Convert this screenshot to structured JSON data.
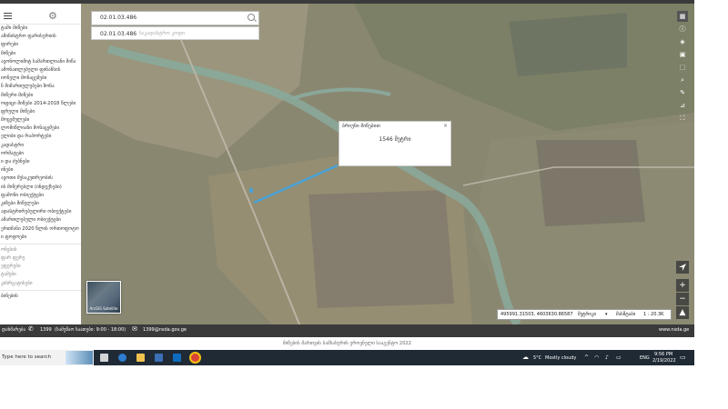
{
  "sidebar": {
    "items": [
      "ტამი მიწები",
      "ამინისტრო ფარისერიის",
      "ფირები",
      "მიწები",
      "ავონოლიმიტ სამართლიანი მიწა",
      "ამონათლებული ფინანსის",
      "იონელი მონაცემები",
      "ნ მიმართულებები ზონა",
      "მიწერი მიწები",
      "ოფიცი მიწები 2014-2018 წლები",
      "ფრული მიწები",
      "მოცემულები",
      "ლომიწლიანი მონაცემები",
      "ელიბი და რაპორტები",
      "კადასტრი",
      "ორმატები",
      "ი და ძებნები",
      "ინები",
      "ავოთი მესაკუთრეობის",
      "ის მიწერებლი (ინდექსები)",
      "ფამონი ობიექტები",
      "კიზები მიწელები",
      "ადასტრირებულირი ობიექტები",
      "ამართლებული ობიექტები",
      "ერთმანი 2020 წლის ორთოფოტო",
      "ი ფოტოები"
    ],
    "sub_items": [
      "ონების",
      "ფარ ფერე",
      "ეფერები",
      "ტამები",
      "კისრგატისები"
    ],
    "bottom_item": "ბინების",
    "thumb_label": "ArcGIS Satellite"
  },
  "search": {
    "value": "02.01.03.486",
    "suggestion_code": "02.01.03.486",
    "suggestion_desc": "საკადასტრო კოდი"
  },
  "popup": {
    "title": "ბრიუნი მიწებით",
    "value": "1546 მეტრი",
    "close": "×"
  },
  "status": {
    "coords": "495991.31503, 4603630.86587",
    "unit": "მეტრიკი",
    "scale_label": "მასშტაბი",
    "scale": "1 : 20.3K"
  },
  "footer": {
    "support": "დახმარება",
    "phone": "1399",
    "hours": "(სამუშაო საათები: 9:00 - 18:00)",
    "email": "1399@nsda.gov.ge",
    "site": "www.nsda.ge"
  },
  "copyright": "მიწების მართვის სამსახურის ეროვნული სააგენტო 2022",
  "taskbar": {
    "search": "Type here to search",
    "weather_temp": "5°C",
    "weather_desc": "Mostly cloudy",
    "lang": "ENG",
    "time": "9:56 PM",
    "date": "2/19/2022"
  },
  "colors": {
    "river": "#8aa89a",
    "line": "#4aa3d8",
    "dark_bar": "#3a3a3a",
    "taskbar": "#1f2a35"
  }
}
